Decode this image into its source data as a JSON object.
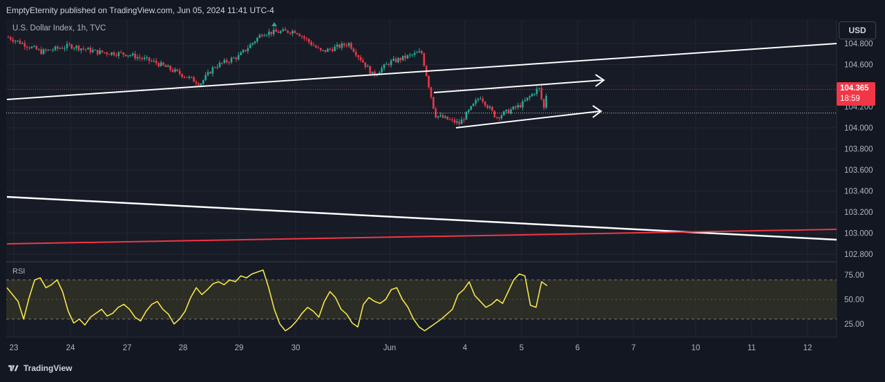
{
  "header": {
    "publisher": "EmptyEternity published on TradingView.com, Jun 05, 2024 11:41 UTC-4"
  },
  "toolbar": {
    "currency_button": "USD"
  },
  "chart": {
    "symbol": "U.S. Dollar Index, 1h, TVC"
  },
  "rsi": {
    "label": "RSI"
  },
  "price_tag": {
    "price": "104.365",
    "countdown": "18:59"
  },
  "footer": {
    "brand": "TradingView"
  },
  "colors": {
    "background": "#171b26",
    "bullish": "#22ab94",
    "bearish": "#f23645",
    "rsi_line": "#f5e74a",
    "rsi_band": "#3b3a24",
    "trendline": "#ffffff",
    "red_line": "#f23645"
  },
  "chart_data": [
    {
      "type": "candlestick",
      "ylim": [
        102.7,
        104.95
      ],
      "price_axis_ticks": [
        "104.800",
        "104.600",
        "104.400",
        "104.200",
        "104.000",
        "103.800",
        "103.600",
        "103.400",
        "103.200",
        "103.000",
        "102.800"
      ],
      "x_axis_ticks": [
        "23",
        "24",
        "27",
        "28",
        "29",
        "30",
        "Jun",
        "4",
        "5",
        "6",
        "7",
        "10",
        "11",
        "12"
      ],
      "last_price": 104.365,
      "dotted_level": 104.14,
      "close_path": [
        {
          "x": "23",
          "y": 104.86
        },
        {
          "x": "23.5",
          "y": 104.72
        },
        {
          "x": "24",
          "y": 104.78
        },
        {
          "x": "24.5",
          "y": 104.72
        },
        {
          "x": "27",
          "y": 104.7
        },
        {
          "x": "27.5",
          "y": 104.62
        },
        {
          "x": "28",
          "y": 104.5
        },
        {
          "x": "28.3",
          "y": 104.42
        },
        {
          "x": "28.5",
          "y": 104.58
        },
        {
          "x": "29",
          "y": 104.68
        },
        {
          "x": "29.4",
          "y": 104.9
        },
        {
          "x": "30",
          "y": 104.92
        },
        {
          "x": "30.5",
          "y": 104.72
        },
        {
          "x": "31",
          "y": 104.8
        },
        {
          "x": "31.5",
          "y": 104.5
        },
        {
          "x": "Jun",
          "y": 104.62
        },
        {
          "x": "Jun 3",
          "y": 104.72
        },
        {
          "x": "Jun 3.6",
          "y": 104.12
        },
        {
          "x": "4",
          "y": 104.04
        },
        {
          "x": "4.3",
          "y": 104.3
        },
        {
          "x": "4.6",
          "y": 104.1
        },
        {
          "x": "5",
          "y": 104.22
        },
        {
          "x": "5.3",
          "y": 104.38
        },
        {
          "x": "5.4",
          "y": 104.18
        },
        {
          "x": "5.45",
          "y": 104.365
        }
      ]
    },
    {
      "type": "line",
      "name": "RSI",
      "ylim": [
        15,
        85
      ],
      "y_axis_ticks": [
        "75.00",
        "50.00",
        "25.00"
      ],
      "band": [
        30,
        70
      ],
      "values": [
        62,
        55,
        48,
        30,
        52,
        70,
        72,
        62,
        65,
        70,
        58,
        38,
        26,
        30,
        24,
        32,
        36,
        40,
        33,
        36,
        42,
        45,
        40,
        32,
        28,
        38,
        45,
        48,
        40,
        35,
        25,
        30,
        38,
        52,
        62,
        55,
        60,
        66,
        68,
        65,
        70,
        68,
        74,
        72,
        76,
        78,
        80,
        62,
        40,
        25,
        18,
        22,
        28,
        36,
        42,
        38,
        32,
        48,
        58,
        52,
        40,
        35,
        26,
        22,
        45,
        52,
        48,
        46,
        50,
        60,
        62,
        50,
        42,
        30,
        22,
        18,
        22,
        26,
        30,
        35,
        40,
        55,
        60,
        68,
        54,
        48,
        42,
        45,
        50,
        46,
        58,
        70,
        76,
        74,
        44,
        42,
        68,
        64
      ]
    }
  ]
}
